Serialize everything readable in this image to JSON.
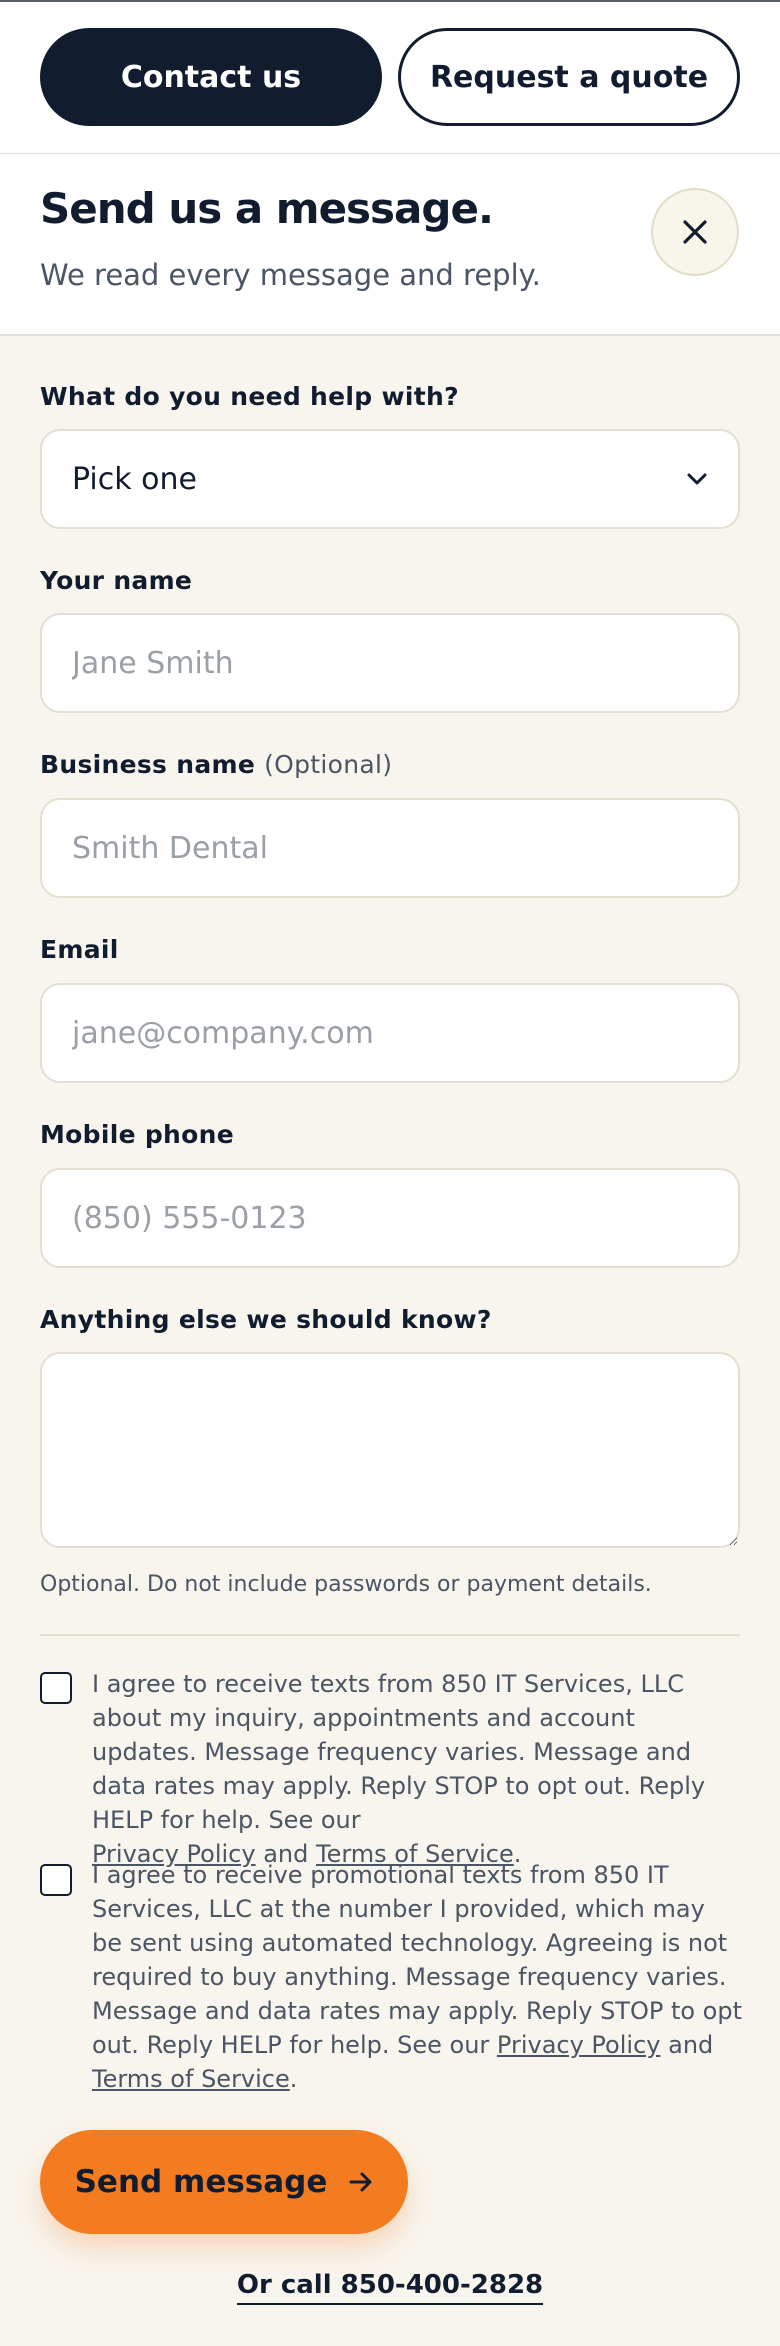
{
  "topbar": {
    "contact_label": "Contact us",
    "quote_label": "Request a quote"
  },
  "header": {
    "title": "Send us a message.",
    "subtitle": "We read every message and reply."
  },
  "form": {
    "help": {
      "label": "What do you need help with?",
      "value": "Pick one"
    },
    "name": {
      "label": "Your name",
      "placeholder": "Jane Smith"
    },
    "business": {
      "label": "Business name",
      "optional": "(Optional)",
      "placeholder": "Smith Dental"
    },
    "email": {
      "label": "Email",
      "placeholder": "jane@company.com"
    },
    "phone": {
      "label": "Mobile phone",
      "placeholder": "(850) 555-0123"
    },
    "notes": {
      "label": "Anything else we should know?",
      "hint": "Optional. Do not include passwords or payment details."
    }
  },
  "consent1": {
    "text": "I agree to receive texts from 850 IT Services, LLC about my inquiry, appointments and account updates. Message frequency varies. Message and data rates may apply. Reply STOP to opt out. Reply HELP for help. See our",
    "privacy": "Privacy Policy",
    "and": "and",
    "terms": "Terms of Service",
    "end": "."
  },
  "consent2": {
    "text": "I agree to receive promotional texts from 850 IT Services, LLC at the number I provided, which may be sent using automated technology. Agreeing is not required to buy anything. Message frequency varies. Message and data rates may apply. Reply STOP to opt out. Reply HELP for help. See our",
    "privacy": "Privacy Policy",
    "and": "and",
    "terms": "Terms of Service",
    "end": "."
  },
  "send_label": "Send message",
  "call_label": "Or call 850-400-2828",
  "icons": {
    "close": "close-icon",
    "chevron": "chevron-down-icon",
    "arrow": "arrow-right-icon"
  },
  "colors": {
    "navy": "#111c2e",
    "orange": "#f47c20",
    "background": "#f8f5ee"
  }
}
